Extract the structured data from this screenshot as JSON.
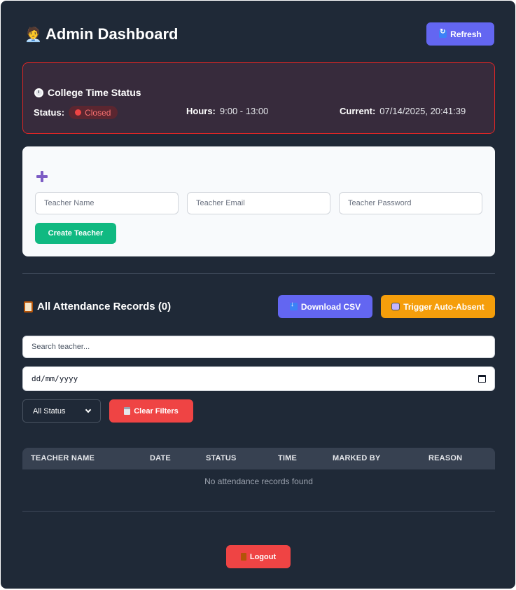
{
  "header": {
    "title": "Admin Dashboard",
    "title_icon": "🧑‍💼",
    "refresh_label": "Refresh"
  },
  "college_time": {
    "title": "College Time Status",
    "status_label": "Status:",
    "status_value": "Closed",
    "hours_label": "Hours:",
    "hours_value": "9:00 - 13:00",
    "current_label": "Current:",
    "current_value": "07/14/2025, 20:41:39"
  },
  "create_teacher": {
    "name_placeholder": "Teacher Name",
    "email_placeholder": "Teacher Email",
    "password_placeholder": "Teacher Password",
    "create_label": "Create Teacher"
  },
  "records": {
    "title": "All Attendance Records (0)",
    "download_label": "Download CSV",
    "trigger_label": "Trigger Auto-Absent",
    "search_placeholder": "Search teacher...",
    "date_value": "dd/mm/yyyy",
    "status_filter_value": "All Status",
    "clear_label": "Clear Filters",
    "columns": [
      "TEACHER NAME",
      "DATE",
      "STATUS",
      "TIME",
      "MARKED BY",
      "REASON"
    ],
    "empty_message": "No attendance records found"
  },
  "footer": {
    "logout_label": "Logout"
  },
  "colors": {
    "background": "#1f2937",
    "primary": "#6366f1",
    "success": "#10b981",
    "warning": "#f59e0b",
    "danger": "#ef4444"
  }
}
